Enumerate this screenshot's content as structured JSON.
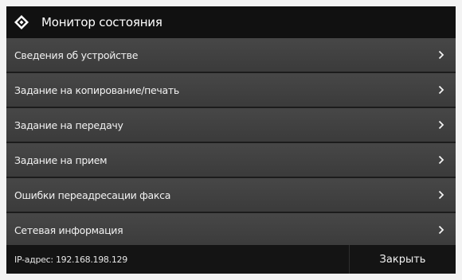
{
  "header": {
    "title": "Монитор состояния",
    "icon": "status-monitor-icon"
  },
  "menu": {
    "items": [
      {
        "label": "Сведения об устройстве"
      },
      {
        "label": "Задание на копирование/печать"
      },
      {
        "label": "Задание на передачу"
      },
      {
        "label": "Задание на прием"
      },
      {
        "label": "Ошибки переадресации факса"
      },
      {
        "label": "Сетевая информация"
      }
    ],
    "chevron_icon": "chevron-right-icon"
  },
  "footer": {
    "ip_text": "IP-адрес: 192.168.198.129",
    "close_label": "Закрыть"
  },
  "colors": {
    "background": "#1c1c1c",
    "item": "#424242",
    "text": "#f2f2f2"
  }
}
